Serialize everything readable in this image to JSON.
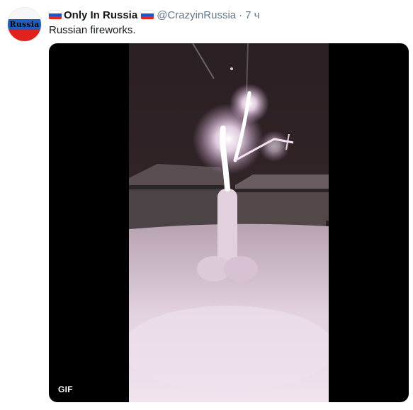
{
  "tweet": {
    "avatar_text": "Russia",
    "display_name": "Only In Russia",
    "handle": "@CrazyinRussia",
    "separator": "·",
    "time": "7 ч",
    "text": "Russian fireworks.",
    "media": {
      "badge": "GIF"
    }
  },
  "colors": {
    "handle_gray": "#657786",
    "text_dark": "#14171a",
    "media_bg": "#000000"
  }
}
